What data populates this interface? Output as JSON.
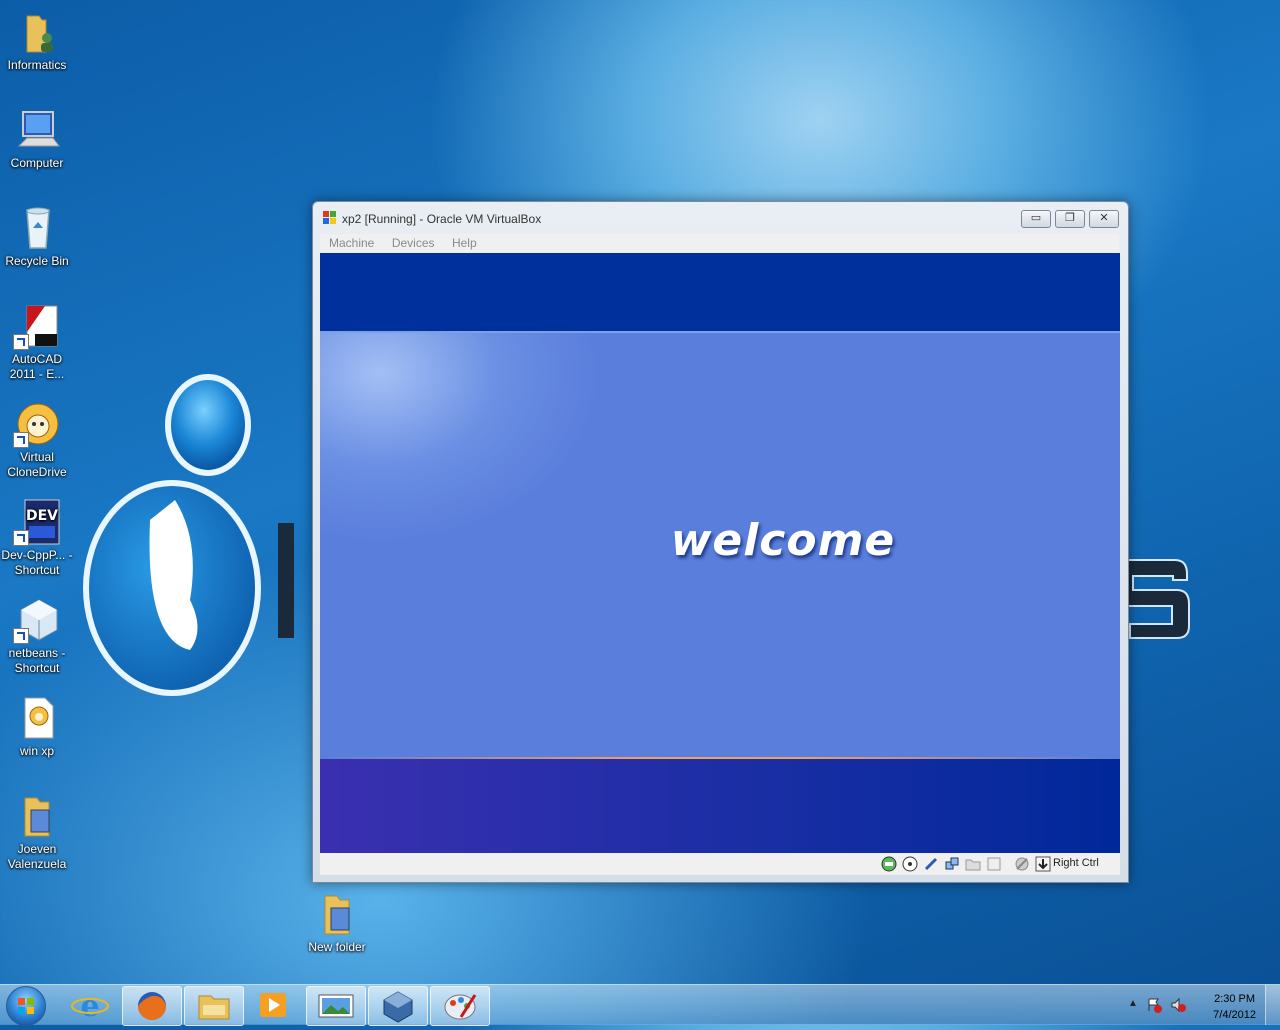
{
  "desktop": {
    "icons": [
      {
        "label": "Informatics",
        "icon": "folder-user-icon"
      },
      {
        "label": "Computer",
        "icon": "computer-icon"
      },
      {
        "label": "Recycle Bin",
        "icon": "recycle-bin-icon"
      },
      {
        "label": "AutoCAD 2011 - E...",
        "icon": "autocad-icon"
      },
      {
        "label": "Virtual CloneDrive",
        "icon": "virtual-clonedrive-icon"
      },
      {
        "label": "Dev-CppP... - Shortcut",
        "icon": "devcpp-icon"
      },
      {
        "label": "netbeans - Shortcut",
        "icon": "netbeans-icon"
      },
      {
        "label": "win xp",
        "icon": "iso-file-icon"
      },
      {
        "label": "Joeven Valenzuela",
        "icon": "folder-icon"
      },
      {
        "label": "New folder",
        "icon": "folder-icon"
      }
    ]
  },
  "window": {
    "title": "xp2 [Running] - Oracle VM VirtualBox",
    "menu": [
      "Machine",
      "Devices",
      "Help"
    ],
    "screen_text": "welcome",
    "host_key": "Right Ctrl",
    "buttons": {
      "minimize": "▭",
      "restore": "❐",
      "close": "✕"
    }
  },
  "taskbar": {
    "items": [
      "internet-explorer-icon",
      "firefox-icon",
      "windows-explorer-icon",
      "media-player-icon",
      "photo-viewer-icon",
      "virtualbox-icon",
      "paint-icon"
    ],
    "time": "2:30 PM",
    "date": "7/4/2012"
  },
  "colors": {
    "xp_blue": "#5a7edc",
    "xp_dark": "#00309c"
  }
}
